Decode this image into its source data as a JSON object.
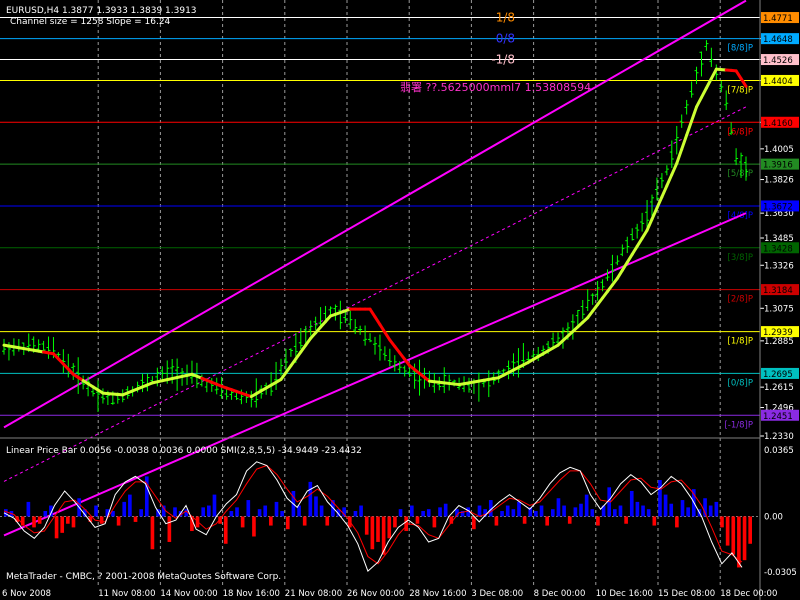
{
  "app": {
    "header": "EURUSD,H4  1.3877 1.3933 1.3839 1.3913",
    "channel_info": "Channel size = 1258 Slope = 16.24",
    "copyright": "MetaTrader - CMBC, ? 2001-2008 MetaQuotes Software Corp."
  },
  "murrey": {
    "levels": [
      {
        "label": "[8/8]P",
        "price": 1.4648,
        "color": "#00aaff"
      },
      {
        "label": "[7/8]P",
        "price": 1.4404,
        "color": "#ffff00"
      },
      {
        "label": "[6/8]P",
        "price": 1.416,
        "color": "#ff0000"
      },
      {
        "label": "[5/8]P",
        "price": 1.3916,
        "color": "#228b22"
      },
      {
        "label": "[4/8]P",
        "price": 1.3672,
        "color": "#0000ff"
      },
      {
        "label": "[3/8]P",
        "price": 1.3428,
        "color": "#006400"
      },
      {
        "label": "[2/8]P",
        "price": 1.3184,
        "color": "#cc0000"
      },
      {
        "label": "[1/8]P",
        "price": 1.2939,
        "color": "#ffff00"
      },
      {
        "label": "[0/8]P",
        "price": 1.2695,
        "color": "#00c0c0"
      },
      {
        "label": "[-1/8]P",
        "price": 1.2451,
        "color": "#8a2be2"
      }
    ],
    "top_labels": [
      {
        "text": "1/8",
        "price": 1.4771,
        "color": "#ff8c00"
      },
      {
        "text": "0/8",
        "price": 1.4648,
        "color": "#3333ff"
      },
      {
        "text": "-1/8",
        "price": 1.4526,
        "color": "#ffc0cb"
      }
    ],
    "extra_boxes": [
      {
        "text": "1.4771",
        "price": 1.4771,
        "color": "#ff8c00"
      },
      {
        "text": "1.4526",
        "price": 1.4526,
        "color": "#ffc0cb"
      }
    ],
    "annotation": "翡署 ??.5625000mml7 1.53808594"
  },
  "indicator": {
    "label": "Linear Price Bar 0.0056 -0.0038 0.0036 0.0000  SMI(2,8,5,5) -34.9449 -23.4432",
    "axis_ticks": [
      "0.0365",
      "0.00",
      "-0.0305"
    ]
  },
  "chart_data": {
    "type": "line",
    "title": "EURUSD,H4",
    "ylim": [
      1.233,
      1.485
    ],
    "price_ticks": [
      1.4648,
      1.4526,
      1.4404,
      1.416,
      1.4005,
      1.3826,
      1.363,
      1.3485,
      1.3326,
      1.3075,
      1.2885,
      1.2615,
      1.2496,
      1.233
    ],
    "x_ticks": [
      "6 Nov 2008",
      "11 Nov 08:00",
      "14 Nov 00:00",
      "18 Nov 16:00",
      "21 Nov 08:00",
      "26 Nov 00:00",
      "28 Nov 16:00",
      "3 Dec 08:00",
      "8 Dec 00:00",
      "10 Dec 16:00",
      "15 Dec 08:00",
      "18 Dec 00:00"
    ],
    "price_keypoints": [
      [
        0,
        1.284
      ],
      [
        6,
        1.286
      ],
      [
        10,
        1.283
      ],
      [
        14,
        1.271
      ],
      [
        18,
        1.259
      ],
      [
        22,
        1.254
      ],
      [
        26,
        1.26
      ],
      [
        30,
        1.266
      ],
      [
        34,
        1.271
      ],
      [
        38,
        1.268
      ],
      [
        42,
        1.262
      ],
      [
        46,
        1.257
      ],
      [
        50,
        1.255
      ],
      [
        54,
        1.262
      ],
      [
        58,
        1.282
      ],
      [
        62,
        1.297
      ],
      [
        66,
        1.306
      ],
      [
        70,
        1.3
      ],
      [
        74,
        1.29
      ],
      [
        78,
        1.277
      ],
      [
        82,
        1.27
      ],
      [
        86,
        1.265
      ],
      [
        90,
        1.264
      ],
      [
        94,
        1.263
      ],
      [
        98,
        1.264
      ],
      [
        102,
        1.272
      ],
      [
        106,
        1.279
      ],
      [
        110,
        1.285
      ],
      [
        114,
        1.294
      ],
      [
        118,
        1.31
      ],
      [
        122,
        1.326
      ],
      [
        126,
        1.345
      ],
      [
        130,
        1.362
      ],
      [
        134,
        1.388
      ],
      [
        138,
        1.425
      ],
      [
        142,
        1.462
      ],
      [
        144,
        1.445
      ],
      [
        146,
        1.428
      ],
      [
        148,
        1.395
      ],
      [
        150,
        1.391
      ]
    ],
    "trend_keypoints": [
      [
        0,
        1.286
      ],
      [
        10,
        1.281
      ],
      [
        14,
        1.269
      ],
      [
        20,
        1.258
      ],
      [
        24,
        1.257
      ],
      [
        30,
        1.264
      ],
      [
        38,
        1.269
      ],
      [
        44,
        1.262
      ],
      [
        50,
        1.256
      ],
      [
        56,
        1.266
      ],
      [
        62,
        1.29
      ],
      [
        66,
        1.303
      ],
      [
        70,
        1.307
      ],
      [
        74,
        1.307
      ],
      [
        78,
        1.289
      ],
      [
        82,
        1.274
      ],
      [
        86,
        1.265
      ],
      [
        92,
        1.263
      ],
      [
        100,
        1.267
      ],
      [
        106,
        1.276
      ],
      [
        112,
        1.286
      ],
      [
        118,
        1.302
      ],
      [
        124,
        1.325
      ],
      [
        130,
        1.353
      ],
      [
        136,
        1.392
      ],
      [
        140,
        1.425
      ],
      [
        144,
        1.447
      ],
      [
        148,
        1.446
      ],
      [
        150,
        1.437
      ]
    ],
    "trend_down_segments": [
      [
        8,
        16
      ],
      [
        40,
        50
      ],
      [
        70,
        86
      ],
      [
        146,
        150
      ]
    ],
    "channel": {
      "lower_start": [
        0,
        1.175
      ],
      "lower_end": [
        150,
        1.363
      ],
      "upper_start": [
        0,
        1.238
      ],
      "upper_end": [
        150,
        1.487
      ]
    },
    "histogram": [
      0.004,
      0.003,
      -0.003,
      -0.005,
      0.008,
      -0.006,
      -0.004,
      0.003,
      0.006,
      -0.012,
      -0.009,
      -0.004,
      -0.006,
      0.01,
      0.004,
      -0.003,
      0.006,
      -0.004,
      0.004,
      0.003,
      -0.005,
      0.008,
      0.012,
      -0.003,
      0.004,
      0.022,
      -0.018,
      0.004,
      0.006,
      -0.014,
      0.005,
      0.003,
      0.004,
      -0.008,
      -0.006,
      0.005,
      0.006,
      0.012,
      -0.004,
      -0.015,
      0.003,
      0.005,
      -0.006,
      0.009,
      -0.011,
      0.004,
      0.006,
      -0.005,
      0.008,
      0.003,
      -0.007,
      0.014,
      0.006,
      -0.005,
      0.019,
      0.011,
      0.006,
      -0.005,
      0.009,
      0.004,
      0.005,
      -0.006,
      0.003,
      0.006,
      -0.01,
      -0.018,
      -0.014,
      -0.021,
      -0.012,
      -0.006,
      0.004,
      -0.008,
      0.006,
      -0.004,
      0.003,
      0.004,
      -0.006,
      0.005,
      0.007,
      -0.004,
      0.004,
      0.003,
      0.005,
      -0.007,
      0.006,
      0.004,
      0.009,
      -0.005,
      0.003,
      0.006,
      0.004,
      0.008,
      -0.004,
      0.005,
      0.003,
      0.006,
      -0.005,
      0.004,
      0.01,
      0.006,
      -0.004,
      0.005,
      0.007,
      0.012,
      0.004,
      -0.005,
      0.006,
      0.016,
      0.004,
      0.006,
      -0.004,
      0.014,
      0.008,
      0.006,
      0.004,
      -0.005,
      0.02,
      0.012,
      0.007,
      -0.006,
      0.009,
      0.005,
      0.015,
      0.004,
      0.01,
      0.006,
      0.008,
      -0.006,
      -0.016,
      -0.021,
      -0.028,
      -0.024,
      -0.015
    ],
    "smi": [
      0.002,
      -0.001,
      -0.008,
      -0.012,
      -0.006,
      0.006,
      0.014,
      0.008,
      0.001,
      -0.006,
      -0.004,
      0.012,
      0.019,
      0.022,
      0.018,
      0.005,
      -0.004,
      -0.002,
      0.006,
      -0.007,
      -0.01,
      0.0,
      0.007,
      0.012,
      0.025,
      0.03,
      0.028,
      0.02,
      0.01,
      0.005,
      0.014,
      0.017,
      0.008,
      0.002,
      -0.005,
      -0.015,
      -0.03,
      -0.025,
      -0.014,
      -0.006,
      -0.002,
      -0.006,
      -0.014,
      -0.012,
      0.0,
      0.006,
      0.003,
      -0.003,
      0.003,
      0.008,
      0.012,
      0.008,
      0.004,
      0.01,
      0.018,
      0.024,
      0.027,
      0.025,
      0.012,
      0.004,
      0.01,
      0.018,
      0.023,
      0.019,
      0.012,
      0.016,
      0.022,
      0.018,
      0.01,
      0.0,
      -0.014,
      -0.026,
      -0.02,
      -0.028
    ],
    "signal": [
      0.003,
      0.001,
      -0.005,
      -0.009,
      -0.008,
      0.0,
      0.008,
      0.009,
      0.004,
      -0.002,
      -0.003,
      0.006,
      0.014,
      0.019,
      0.019,
      0.011,
      0.003,
      -0.001,
      0.003,
      -0.002,
      -0.007,
      -0.004,
      0.003,
      0.009,
      0.018,
      0.026,
      0.028,
      0.023,
      0.015,
      0.008,
      0.011,
      0.015,
      0.011,
      0.005,
      -0.001,
      -0.009,
      -0.022,
      -0.026,
      -0.019,
      -0.01,
      -0.004,
      -0.005,
      -0.01,
      -0.012,
      -0.005,
      0.002,
      0.003,
      0.0,
      0.002,
      0.006,
      0.01,
      0.009,
      0.006,
      0.008,
      0.014,
      0.02,
      0.025,
      0.025,
      0.018,
      0.009,
      0.008,
      0.014,
      0.02,
      0.021,
      0.016,
      0.015,
      0.019,
      0.02,
      0.014,
      0.006,
      -0.006,
      -0.019,
      -0.021,
      -0.025
    ],
    "indicator_ylim": [
      -0.0305,
      0.0365
    ]
  }
}
